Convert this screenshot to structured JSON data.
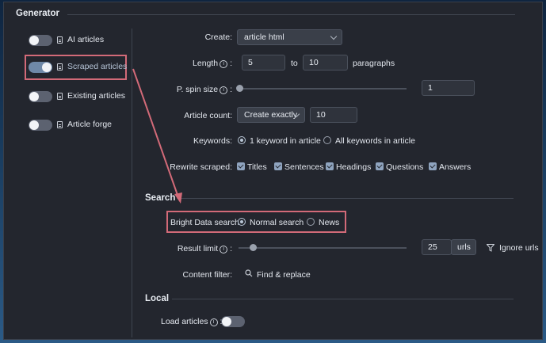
{
  "sections": {
    "generator": "Generator",
    "search": "Search",
    "local": "Local"
  },
  "sidebar": {
    "items": [
      {
        "label": "AI articles",
        "on": false
      },
      {
        "label": "Scraped articles",
        "on": true
      },
      {
        "label": "Existing articles",
        "on": false
      },
      {
        "label": "Article forge",
        "on": false
      }
    ]
  },
  "create": {
    "label": "Create:",
    "value": "article html"
  },
  "length": {
    "label": "Length",
    "from": "5",
    "to_label": "to",
    "to": "10",
    "unit": "paragraphs"
  },
  "spin": {
    "label": "P. spin size",
    "value": "1",
    "level": 0.0
  },
  "count": {
    "label": "Article count:",
    "mode": "Create exactly",
    "value": "10"
  },
  "keywords": {
    "label": "Keywords:",
    "option1": "1 keyword in article",
    "option2": "All keywords in article"
  },
  "rewrite": {
    "label": "Rewrite scraped:",
    "items": [
      "Titles",
      "Sentences",
      "Headings",
      "Questions",
      "Answers"
    ]
  },
  "bright": {
    "label": "Bright Data search:",
    "option1": "Normal search",
    "option2": "News"
  },
  "result": {
    "label": "Result limit",
    "value": "25",
    "unit": "urls",
    "ignore": "Ignore urls"
  },
  "filter": {
    "label": "Content filter:",
    "button": "Find & replace"
  },
  "load": {
    "label": "Load articles",
    "on": false
  },
  "info_glyph": "i",
  "colon": ":",
  "colors": {
    "highlight": "#d26a78",
    "panel": "#23262e",
    "accent": "#8fa4bf"
  }
}
